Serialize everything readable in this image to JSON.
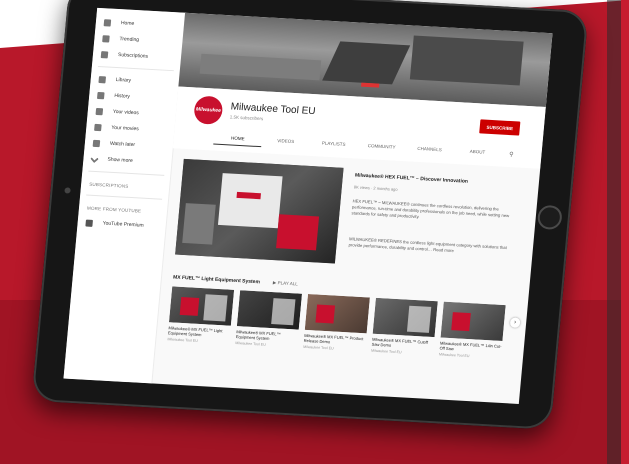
{
  "sidebar": {
    "items": [
      {
        "label": "Home",
        "icon": "home-icon"
      },
      {
        "label": "Trending",
        "icon": "flame-icon"
      },
      {
        "label": "Subscriptions",
        "icon": "subscriptions-icon"
      }
    ],
    "library": [
      {
        "label": "Library",
        "icon": "library-icon"
      },
      {
        "label": "History",
        "icon": "history-icon"
      },
      {
        "label": "Your videos",
        "icon": "video-icon"
      },
      {
        "label": "Your movies",
        "icon": "movie-icon"
      },
      {
        "label": "Watch later",
        "icon": "clock-icon"
      },
      {
        "label": "Show more",
        "icon": "chevron-down-icon"
      }
    ],
    "subscriptions_heading": "SUBSCRIPTIONS",
    "more_heading": "MORE FROM YOUTUBE",
    "more_items": [
      {
        "label": "YouTube Premium",
        "icon": "youtube-icon"
      }
    ]
  },
  "channel": {
    "avatar_text": "Milwaukee",
    "name": "Milwaukee Tool EU",
    "subscribers": "1.5K subscribers",
    "subscribe_label": "SUBSCRIBE",
    "tabs": [
      "HOME",
      "VIDEOS",
      "PLAYLISTS",
      "COMMUNITY",
      "CHANNELS",
      "ABOUT"
    ],
    "active_tab": "HOME"
  },
  "featured": {
    "title": "Milwaukee® HEX FUEL™ – Discover Innovation",
    "meta": "8K views · 2 months ago",
    "description": "HEX FUEL™ – MILWAUKEE® continues the cordless revolution, delivering the performance, run-time and durability professionals on the job need, while setting new standards for safety and productivity.",
    "description2": "MILWAUKEE® REDEFINES the cordless light equipment category with solutions that provide performance, durability and control… Read more"
  },
  "shelf": {
    "title": "MX FUEL™ Light Equipment System",
    "play_all": "PLAY ALL",
    "videos": [
      {
        "title": "Milwaukee® MX FUEL™ Light Equipment System",
        "meta": "Milwaukee Tool EU"
      },
      {
        "title": "Milwaukee® MX FUEL™ Equipment System",
        "meta": "Milwaukee Tool EU"
      },
      {
        "title": "Milwaukee® MX FUEL™ Product Release Demo",
        "meta": "Milwaukee Tool EU"
      },
      {
        "title": "Milwaukee® MX FUEL™ Cutoff Saw Demo",
        "meta": "Milwaukee Tool EU"
      },
      {
        "title": "Milwaukee® MX FUEL™ 14in Cut-Off Saw",
        "meta": "Milwaukee Tool EU"
      }
    ]
  },
  "colors": {
    "brand_red": "#c8102e",
    "subscribe_red": "#cc0000",
    "background_red": "#b8182a"
  }
}
